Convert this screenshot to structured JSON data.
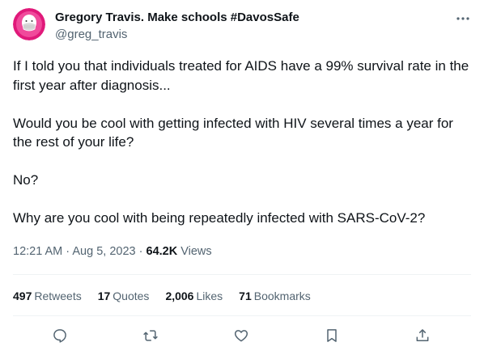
{
  "author": {
    "display_name": "Gregory Travis. Make schools #DavosSafe",
    "handle": "@greg_travis",
    "avatar_icon": "masked-face-avatar",
    "avatar_color": "#e0197a"
  },
  "tweet": {
    "paragraphs": [
      "If I told you that individuals treated for AIDS have a 99% survival rate in the first year after diagnosis...",
      "Would you be cool with getting infected with HIV several times a year for the rest of your life?",
      "No?",
      "Why are you cool with being repeatedly infected with SARS-CoV-2?"
    ]
  },
  "meta": {
    "time": "12:21 AM",
    "separator": "·",
    "date": "Aug 5, 2023",
    "views_count": "64.2K",
    "views_label": "Views"
  },
  "stats": {
    "retweets": {
      "count": "497",
      "label": "Retweets"
    },
    "quotes": {
      "count": "17",
      "label": "Quotes"
    },
    "likes": {
      "count": "2,006",
      "label": "Likes"
    },
    "bookmarks": {
      "count": "71",
      "label": "Bookmarks"
    }
  },
  "actions": [
    "reply-icon",
    "retweet-icon",
    "like-icon",
    "bookmark-icon",
    "share-icon"
  ],
  "colors": {
    "text": "#0f1419",
    "secondary": "#536471",
    "divider": "#eff3f4"
  }
}
